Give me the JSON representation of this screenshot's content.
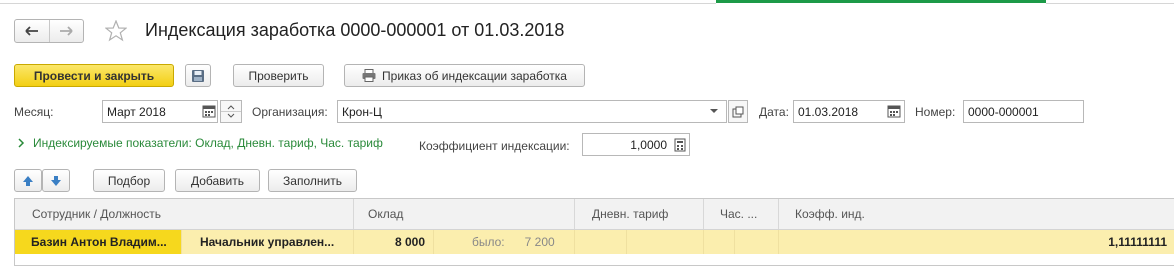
{
  "colors": {
    "accent": "#f3cf14",
    "row_highlight": "#fbeeae",
    "green_text": "#2a8a3a",
    "tab_green": "#1c9a48"
  },
  "icons": {
    "back": "arrow-left-icon",
    "forward": "arrow-right-icon",
    "favorite": "star-icon",
    "save": "floppy-icon",
    "print": "printer-icon",
    "calendar": "calendar-icon",
    "calculator": "calculator-icon",
    "up": "arrow-up-icon",
    "down": "arrow-down-icon",
    "open": "open-window-icon",
    "dropdown": "chevron-down-icon",
    "expand": "chevron-right-icon"
  },
  "header": {
    "title": "Индексация заработка 0000-000001 от 01.03.2018"
  },
  "toolbar": {
    "post_close": "Провести и закрыть",
    "check": "Проверить",
    "print_order": "Приказ об индексации заработка"
  },
  "form": {
    "month_label": "Месяц:",
    "month_value": "Март 2018",
    "org_label": "Организация:",
    "org_value": "Крон-Ц",
    "date_label": "Дата:",
    "date_value": "01.03.2018",
    "number_label": "Номер:",
    "number_value": "0000-000001",
    "indexed_link": "Индексируемые показатели: Оклад, Дневн. тариф, Час. тариф",
    "coef_label": "Коэффициент индексации:",
    "coef_value": "1,0000"
  },
  "table_toolbar": {
    "select": "Подбор",
    "add": "Добавить",
    "fill": "Заполнить"
  },
  "table": {
    "headers": [
      "Сотрудник / Должность",
      "Оклад",
      "Дневн. тариф",
      "Час. ...",
      "Коэфф. инд."
    ],
    "rows": [
      {
        "employee": "Базин Антон Владим...",
        "position": "Начальник управлен...",
        "salary": "8 000",
        "was_label": "было:",
        "was_value": "7 200",
        "coef": "1,11111111"
      }
    ]
  }
}
